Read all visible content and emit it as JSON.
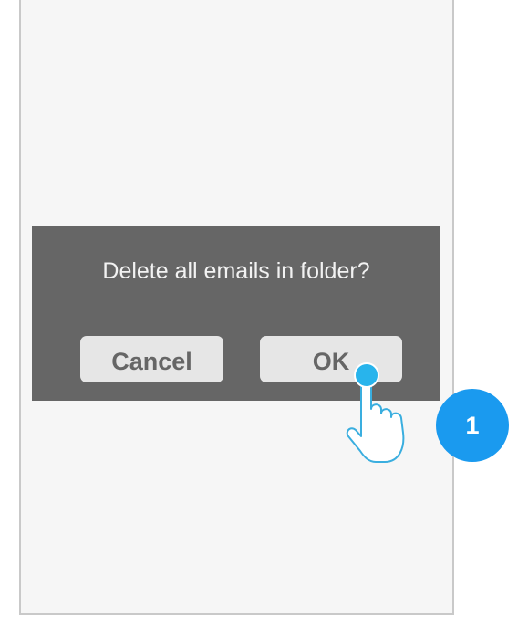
{
  "dialog": {
    "message": "Delete all emails in folder?",
    "cancel_label": "Cancel",
    "ok_label": "OK"
  },
  "annotation": {
    "step_number": "1",
    "pointer_icon": "tap-hand-icon"
  },
  "colors": {
    "screen_bg": "#f6f6f6",
    "screen_border": "#c9c9c9",
    "dialog_bg": "#666666",
    "button_bg": "#e6e6e6",
    "button_text": "#666666",
    "accent": "#1a9aef",
    "tap_dot": "#28b4ec"
  }
}
